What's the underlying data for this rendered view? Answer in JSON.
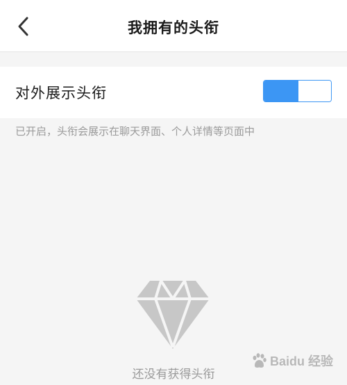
{
  "header": {
    "title": "我拥有的头衔",
    "back_icon": "chevron-left-icon"
  },
  "setting": {
    "label": "对外展示头衔",
    "toggle_on": true,
    "accent_color": "#3c96f4"
  },
  "hint": "已开启，头衔会展示在聊天界面、个人详情等页面中",
  "empty_state": {
    "icon": "diamond-icon",
    "text": "还没有获得头衔"
  },
  "watermark": {
    "text": "Baidu 经验",
    "icon": "baidu-paw-icon"
  }
}
